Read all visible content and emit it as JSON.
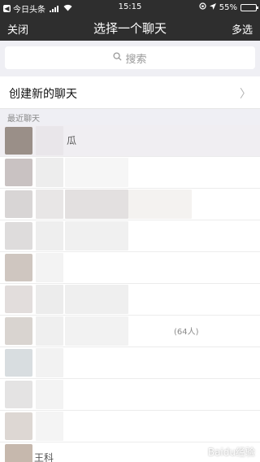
{
  "status_bar": {
    "back_app": "今日头条",
    "time": "15:15",
    "battery": "55%",
    "battery_level": 0.55
  },
  "nav": {
    "close_label": "关闭",
    "title": "选择一个聊天",
    "multi_select_label": "多选"
  },
  "search": {
    "placeholder": "搜索"
  },
  "create_chat": {
    "label": "创建新的聊天"
  },
  "recent_section": {
    "label": "最近聊天"
  },
  "chats": [
    {
      "name": "瓜",
      "count": ""
    },
    {
      "name": "",
      "count": ""
    },
    {
      "name": "",
      "count": ""
    },
    {
      "name": "",
      "count": ""
    },
    {
      "name": "",
      "count": ""
    },
    {
      "name": "",
      "count": ""
    },
    {
      "name": "",
      "count": "(64人)"
    },
    {
      "name": "",
      "count": ""
    },
    {
      "name": "",
      "count": ""
    },
    {
      "name": "",
      "count": ""
    },
    {
      "name": "王科",
      "count": ""
    }
  ],
  "watermark": "Baidu经验",
  "colors": {
    "nav_background": "#2e2e2e",
    "list_background": "#efeff4",
    "selected_row": "#f0eef2"
  }
}
